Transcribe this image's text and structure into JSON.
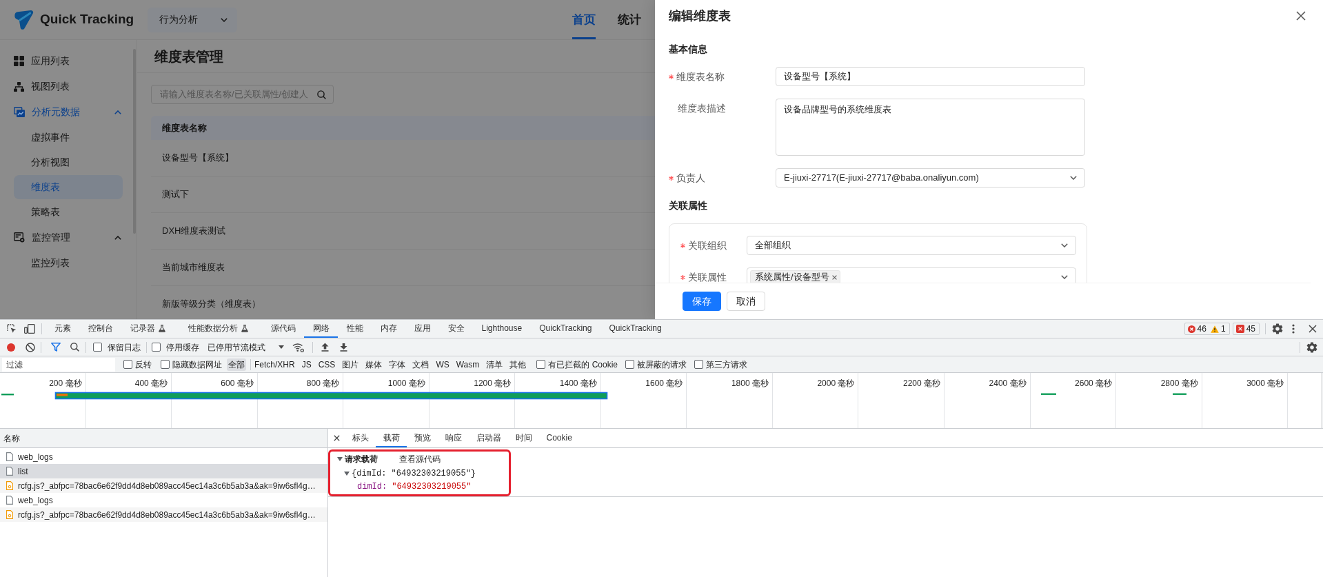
{
  "app": {
    "logo_text": "Quick Tracking",
    "workspace_select": {
      "value": "行为分析"
    },
    "nav": [
      {
        "label": "首页",
        "selected": true
      },
      {
        "label": "统计",
        "selected": false
      }
    ],
    "sidebar": {
      "items": [
        {
          "label": "应用列表",
          "selected": false
        },
        {
          "label": "视图列表",
          "selected": false
        },
        {
          "label": "分析元数据",
          "selected": false,
          "expanded": true,
          "children": [
            {
              "label": "虚拟事件",
              "selected": false
            },
            {
              "label": "分析视图",
              "selected": false
            },
            {
              "label": "维度表",
              "selected": true
            },
            {
              "label": "策略表",
              "selected": false
            }
          ]
        },
        {
          "label": "监控管理",
          "selected": false,
          "expanded": true,
          "children": [
            {
              "label": "监控列表",
              "selected": false
            }
          ]
        }
      ]
    },
    "page_title": "维度表管理",
    "search": {
      "placeholder": "请输入维度表名称/已关联属性/创建人"
    },
    "table": {
      "columns": [
        "维度表名称"
      ],
      "rows": [
        [
          "设备型号【系统】"
        ],
        [
          "测试下"
        ],
        [
          "DXH维度表测试"
        ],
        [
          "当前城市维度表"
        ],
        [
          "新版等级分类（维度表）"
        ]
      ]
    }
  },
  "drawer": {
    "title": "编辑维度表",
    "sections": [
      {
        "title": "基本信息",
        "boxed": false,
        "fields": [
          {
            "kind": "input",
            "label": "维度表名称",
            "required": true,
            "value": "设备型号【系统】"
          },
          {
            "kind": "textarea",
            "label": "维度表描述",
            "required": false,
            "value": "设备品牌型号的系统维度表"
          },
          {
            "kind": "select",
            "label": "负责人",
            "required": true,
            "value": "E-jiuxi-27717(E-jiuxi-27717@baba.onaliyun.com)"
          }
        ]
      },
      {
        "title": "关联属性",
        "boxed": true,
        "fields": [
          {
            "kind": "select",
            "label": "关联组织",
            "required": true,
            "value": "全部组织"
          },
          {
            "kind": "tag-select",
            "label": "关联属性",
            "required": true,
            "tags": [
              "系统属性/设备型号"
            ]
          }
        ]
      }
    ],
    "buttons": [
      {
        "label": "保存",
        "kind": "primary"
      },
      {
        "label": "取消",
        "kind": "default"
      }
    ]
  },
  "devtools": {
    "tabs": [
      {
        "label": "元素",
        "selected": false,
        "experimental": false
      },
      {
        "label": "控制台",
        "selected": false,
        "experimental": false
      },
      {
        "label": "记录器",
        "selected": false,
        "experimental": true
      },
      {
        "label": "性能数据分析",
        "selected": false,
        "experimental": true
      },
      {
        "label": "源代码",
        "selected": false,
        "experimental": false
      },
      {
        "label": "网络",
        "selected": true,
        "experimental": false
      },
      {
        "label": "性能",
        "selected": false,
        "experimental": false
      },
      {
        "label": "内存",
        "selected": false,
        "experimental": false
      },
      {
        "label": "应用",
        "selected": false,
        "experimental": false
      },
      {
        "label": "安全",
        "selected": false,
        "experimental": false
      },
      {
        "label": "Lighthouse",
        "selected": false,
        "experimental": false
      },
      {
        "label": "QuickTracking",
        "selected": false,
        "experimental": false
      },
      {
        "label": "QuickTracking",
        "selected": false,
        "experimental": false
      }
    ],
    "counters": {
      "errors": "46",
      "warnings": "1",
      "issues": "45"
    },
    "network_toolbar": {
      "recording": true,
      "options": [
        {
          "label": "保留日志",
          "checked": false
        },
        {
          "label": "停用缓存",
          "checked": false
        }
      ],
      "throttling": "已停用节流模式"
    },
    "filter_bar": {
      "placeholder": "过滤",
      "options_left": [
        {
          "label": "反转",
          "checked": false
        },
        {
          "label": "隐藏数据网址",
          "checked": false
        }
      ],
      "types": [
        {
          "label": "全部",
          "selected": true
        },
        {
          "label": "Fetch/XHR",
          "selected": false
        },
        {
          "label": "JS",
          "selected": false
        },
        {
          "label": "CSS",
          "selected": false
        },
        {
          "label": "图片",
          "selected": false
        },
        {
          "label": "媒体",
          "selected": false
        },
        {
          "label": "字体",
          "selected": false
        },
        {
          "label": "文档",
          "selected": false
        },
        {
          "label": "WS",
          "selected": false
        },
        {
          "label": "Wasm",
          "selected": false
        },
        {
          "label": "清单",
          "selected": false
        },
        {
          "label": "其他",
          "selected": false
        }
      ],
      "options_right": [
        {
          "label": "有已拦截的 Cookie",
          "checked": false
        },
        {
          "label": "被屏蔽的请求",
          "checked": false
        },
        {
          "label": "第三方请求",
          "checked": false
        }
      ]
    },
    "timeline": {
      "ticks": [
        "200 毫秒",
        "400 毫秒",
        "600 毫秒",
        "800 毫秒",
        "1000 毫秒",
        "1200 毫秒",
        "1400 毫秒",
        "1600 毫秒",
        "1800 毫秒",
        "2000 毫秒",
        "2200 毫秒",
        "2400 毫秒",
        "2600 毫秒",
        "2800 毫秒",
        "3000 毫秒"
      ]
    },
    "requests": {
      "column": "名称",
      "rows": [
        {
          "name": "web_logs",
          "kind": "document",
          "selected": false
        },
        {
          "name": "list",
          "kind": "document",
          "selected": true
        },
        {
          "name": "rcfg.js?_abfpc=78bac6e62f9dd4d8eb089acc45ec14a3c6b5ab3a&ak=9iw6sfl4g…",
          "kind": "script",
          "selected": false
        },
        {
          "name": "web_logs",
          "kind": "document",
          "selected": false
        },
        {
          "name": "rcfg.js?_abfpc=78bac6e62f9dd4d8eb089acc45ec14a3c6b5ab3a&ak=9iw6sfl4g…",
          "kind": "script",
          "selected": false
        }
      ]
    },
    "details": {
      "tabs": [
        {
          "label": "标头",
          "selected": false
        },
        {
          "label": "载荷",
          "selected": true
        },
        {
          "label": "预览",
          "selected": false
        },
        {
          "label": "响应",
          "selected": false
        },
        {
          "label": "启动器",
          "selected": false
        },
        {
          "label": "时间",
          "selected": false
        },
        {
          "label": "Cookie",
          "selected": false
        }
      ],
      "payload": {
        "highlighted": true,
        "title": "请求载荷",
        "expanded": true,
        "view_source": "查看源代码",
        "object": {
          "summary": "{dimId: \"64932303219055\"}",
          "expanded": true,
          "properties": [
            {
              "key": "dimId:",
              "value": "\"64932303219055\""
            }
          ]
        }
      }
    }
  }
}
